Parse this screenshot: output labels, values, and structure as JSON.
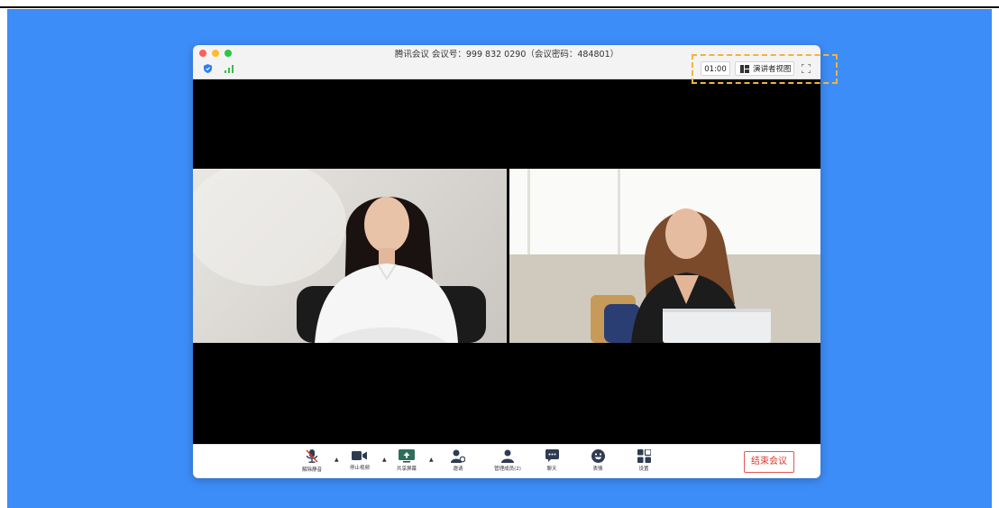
{
  "window": {
    "title": "腾讯会议 会议号：999 832 0290（会议密码：484801）",
    "timer": "01:00",
    "speaker_view_label": "演讲者视图"
  },
  "status_icons": [
    "shield-icon",
    "signal-icon"
  ],
  "toolbar": {
    "unmute_label": "解除静音",
    "stop_video_label": "停止视频",
    "share_screen_label": "共享屏幕",
    "invite_label": "邀请",
    "manage_members_label": "管理成员(2)",
    "chat_label": "聊天",
    "reactions_label": "表情",
    "settings_label": "设置",
    "end_meeting_label": "结束会议"
  },
  "colors": {
    "backdrop": "#3d8df8",
    "end_meeting": "#e0382f",
    "highlight": "#f0b43b",
    "icon": "#2f3b52"
  }
}
